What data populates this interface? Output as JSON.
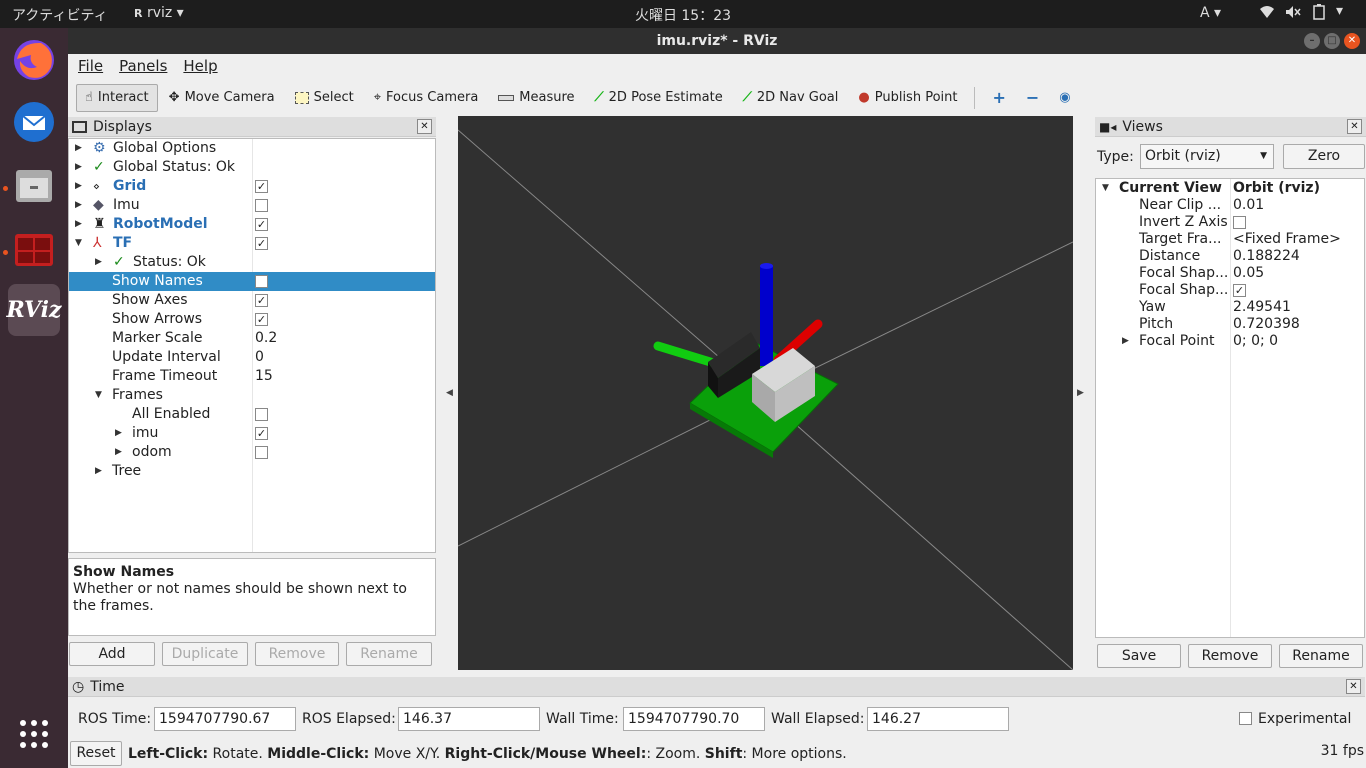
{
  "topbar": {
    "activities": "アクティビティ",
    "app_name": "rviz",
    "clock": "火曜日 15：23",
    "ime": "A"
  },
  "window": {
    "title": "imu.rviz* - RViz"
  },
  "menu": [
    "File",
    "Panels",
    "Help"
  ],
  "toolbar": {
    "interact": "Interact",
    "move_camera": "Move Camera",
    "select": "Select",
    "focus_camera": "Focus Camera",
    "measure": "Measure",
    "pose_estimate": "2D Pose Estimate",
    "nav_goal": "2D Nav Goal",
    "publish_point": "Publish Point"
  },
  "displays": {
    "title": "Displays",
    "global_options": "Global Options",
    "global_status": "Global Status: Ok",
    "grid": "Grid",
    "imu": "Imu",
    "robot_model": "RobotModel",
    "tf": "TF",
    "tf_status": "Status: Ok",
    "show_names": "Show Names",
    "show_axes": "Show Axes",
    "show_arrows": "Show Arrows",
    "marker_scale": "Marker Scale",
    "marker_scale_val": "0.2",
    "update_interval": "Update Interval",
    "update_interval_val": "0",
    "frame_timeout": "Frame Timeout",
    "frame_timeout_val": "15",
    "frames": "Frames",
    "all_enabled": "All Enabled",
    "frame_imu": "imu",
    "frame_odom": "odom",
    "tree": "Tree",
    "desc_title": "Show Names",
    "desc_text": "Whether or not names should be shown next to the frames.",
    "buttons": {
      "add": "Add",
      "duplicate": "Duplicate",
      "remove": "Remove",
      "rename": "Rename"
    }
  },
  "views": {
    "title": "Views",
    "type_label": "Type:",
    "type_value": "Orbit (rviz)",
    "zero": "Zero",
    "current_view": "Current View",
    "current_view_val": "Orbit (rviz)",
    "near_clip": "Near Clip ...",
    "near_clip_val": "0.01",
    "invert_z": "Invert Z Axis",
    "target_frame": "Target Fra...",
    "target_frame_val": "<Fixed Frame>",
    "distance": "Distance",
    "distance_val": "0.188224",
    "focal_shape1": "Focal Shap...",
    "focal_shape1_val": "0.05",
    "focal_shape2": "Focal Shap...",
    "yaw": "Yaw",
    "yaw_val": "2.49541",
    "pitch": "Pitch",
    "pitch_val": "0.720398",
    "focal_point": "Focal Point",
    "focal_point_val": "0; 0; 0",
    "buttons": {
      "save": "Save",
      "remove": "Remove",
      "rename": "Rename"
    }
  },
  "time": {
    "title": "Time",
    "ros_time_label": "ROS Time:",
    "ros_time": "1594707790.67",
    "ros_elapsed_label": "ROS Elapsed:",
    "ros_elapsed": "146.37",
    "wall_time_label": "Wall Time:",
    "wall_time": "1594707790.70",
    "wall_elapsed_label": "Wall Elapsed:",
    "wall_elapsed": "146.27",
    "experimental": "Experimental"
  },
  "status": {
    "reset": "Reset",
    "left_click": "Left-Click:",
    "left_click_txt": " Rotate. ",
    "middle_click": "Middle-Click:",
    "middle_click_txt": " Move X/Y. ",
    "right_click": "Right-Click/Mouse Wheel:",
    "right_click_txt": ": Zoom. ",
    "shift": "Shift",
    "shift_txt": ": More options.",
    "fps": "31 fps"
  },
  "colors": {
    "selection": "#308cc6",
    "viewport_bg": "#303030",
    "dock_bg": "#3a2a33"
  }
}
